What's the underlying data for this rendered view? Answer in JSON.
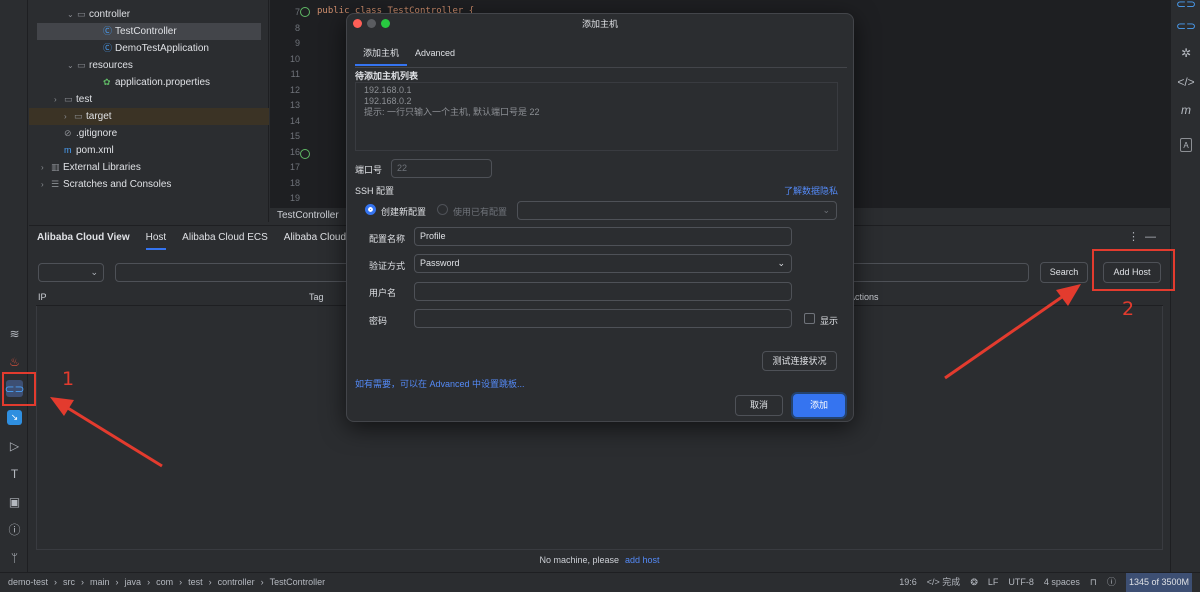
{
  "project_tree": [
    {
      "name": "controller",
      "indent": 1,
      "chev": "v",
      "icon": "folder"
    },
    {
      "name": "TestController",
      "indent": 2,
      "chev": "",
      "icon": "class",
      "selected": true
    },
    {
      "name": "DemoTestApplication",
      "indent": 2,
      "chev": "",
      "icon": "class"
    },
    {
      "name": "resources",
      "indent": 1,
      "chev": "v",
      "icon": "folder"
    },
    {
      "name": "application.properties",
      "indent": 2,
      "chev": "",
      "icon": "leaf"
    },
    {
      "name": "test",
      "indent": 0,
      "chev": ">",
      "icon": "folder"
    },
    {
      "name": "target",
      "indent": 0,
      "chev": ">",
      "icon": "folder",
      "highlight": true
    },
    {
      "name": ".gitignore",
      "indent": 0,
      "chev": "",
      "icon": "ignore"
    },
    {
      "name": "pom.xml",
      "indent": 0,
      "chev": "",
      "icon": "maven"
    },
    {
      "name": "External Libraries",
      "indent": -1,
      "chev": ">",
      "icon": "libs"
    },
    {
      "name": "Scratches and Consoles",
      "indent": -1,
      "chev": ">",
      "icon": "scratch"
    }
  ],
  "editor": {
    "code_line": "public class TestController {",
    "line_numbers": [
      "7",
      "8",
      "9",
      "10",
      "11",
      "12",
      "13",
      "14",
      "15",
      "16",
      "17",
      "18",
      "19"
    ],
    "tab_label": "TestController"
  },
  "tool_window": {
    "tabs": [
      "Alibaba Cloud View",
      "Host",
      "Alibaba Cloud ECS",
      "Alibaba Cloud R"
    ],
    "active_tab": 1,
    "search_button": "Search",
    "add_host_button": "Add Host",
    "columns": {
      "ip": "IP",
      "tag": "Tag",
      "actions": "Actions"
    },
    "empty_text": "No machine, please",
    "empty_link": "add host"
  },
  "dialog": {
    "title": "添加主机",
    "tabs": [
      "添加主机",
      "Advanced"
    ],
    "host_list_label": "待添加主机列表",
    "host_list_lines": [
      "192.168.0.1",
      "192.168.0.2",
      "提示: 一行只输入一个主机, 默认端口号是 22"
    ],
    "port_label": "端口号",
    "port_placeholder": "22",
    "ssh_label": "SSH 配置",
    "privacy_link": "了解数据隐私",
    "radio_new": "创建新配置",
    "radio_existing": "使用已有配置",
    "config_name_label": "配置名称",
    "config_name_value": "Profile",
    "auth_label": "验证方式",
    "auth_value": "Password",
    "username_label": "用户名",
    "password_label": "密码",
    "show_label": "显示",
    "test_button": "测试连接状况",
    "advanced_hint": "如有需要，可以在 Advanced 中设置跳板...",
    "cancel_button": "取消",
    "add_button": "添加"
  },
  "statusbar": {
    "breadcrumb": [
      "demo-test",
      "src",
      "main",
      "java",
      "com",
      "test",
      "controller",
      "TestController"
    ],
    "position": "19:6",
    "ai_status": "完成",
    "line_sep": "LF",
    "encoding": "UTF-8",
    "indent": "4 spaces",
    "memory": "1345 of 3500M"
  },
  "annotations": {
    "one": "1",
    "two": "2"
  },
  "colors": {
    "accent": "#3574f0",
    "annotation": "#e33b2e",
    "link": "#548af7"
  }
}
